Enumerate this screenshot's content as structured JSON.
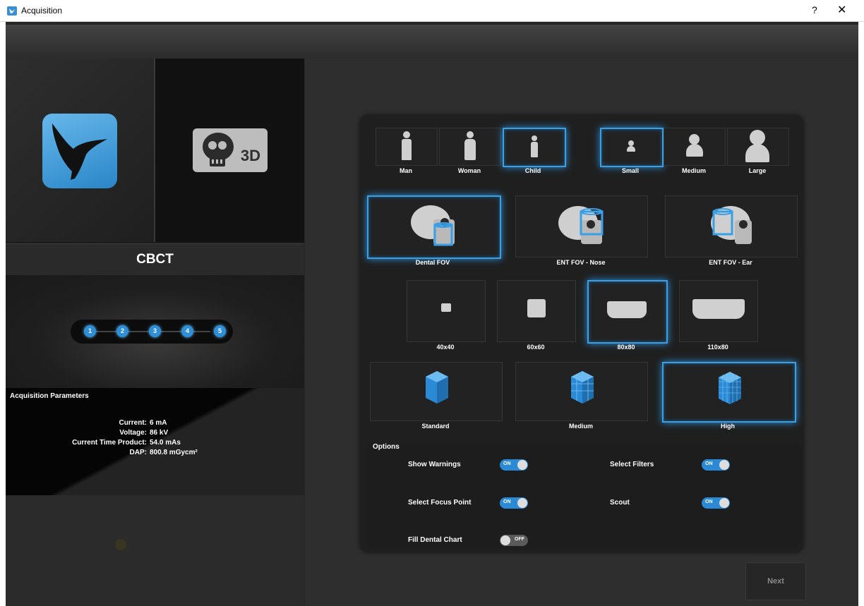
{
  "window": {
    "title": "Acquisition",
    "help_label": "?",
    "close_label": "✕"
  },
  "left": {
    "mode_title": "CBCT",
    "mode_3d_label": "3D",
    "steps": [
      "1",
      "2",
      "3",
      "4",
      "5"
    ],
    "params": {
      "title": "Acquisition Parameters",
      "rows": [
        {
          "label": "Current:",
          "value": "6 mA"
        },
        {
          "label": "Voltage:",
          "value": "86 kV"
        },
        {
          "label": "Current Time Product:",
          "value": "54.0 mAs"
        },
        {
          "label": "DAP:",
          "value": "800.8 mGycm²"
        }
      ]
    }
  },
  "patient": {
    "types": [
      {
        "label": "Man",
        "selected": false
      },
      {
        "label": "Woman",
        "selected": false
      },
      {
        "label": "Child",
        "selected": true
      }
    ],
    "sizes": [
      {
        "label": "Small",
        "selected": true
      },
      {
        "label": "Medium",
        "selected": false
      },
      {
        "label": "Large",
        "selected": false
      }
    ]
  },
  "fov_regions": [
    {
      "label": "Dental FOV",
      "selected": true
    },
    {
      "label": "ENT FOV - Nose",
      "selected": false
    },
    {
      "label": "ENT FOV - Ear",
      "selected": false
    }
  ],
  "fov_sizes": [
    {
      "label": "40x40",
      "selected": false
    },
    {
      "label": "60x60",
      "selected": false
    },
    {
      "label": "80x80",
      "selected": true
    },
    {
      "label": "110x80",
      "selected": false
    }
  ],
  "resolution": [
    {
      "label": "Standard",
      "selected": false
    },
    {
      "label": "Medium",
      "selected": false
    },
    {
      "label": "High",
      "selected": true
    }
  ],
  "options": {
    "title": "Options",
    "items": [
      {
        "label": "Show Warnings",
        "state": "ON"
      },
      {
        "label": "Select Filters",
        "state": "ON"
      },
      {
        "label": "Select Focus Point",
        "state": "ON"
      },
      {
        "label": "Scout",
        "state": "ON"
      },
      {
        "label": "Fill Dental Chart",
        "state": "OFF"
      }
    ]
  },
  "next_label": "Next",
  "colors": {
    "accent": "#2e8fd6",
    "panel": "#1f1f1f",
    "background": "#2e2e2e"
  }
}
